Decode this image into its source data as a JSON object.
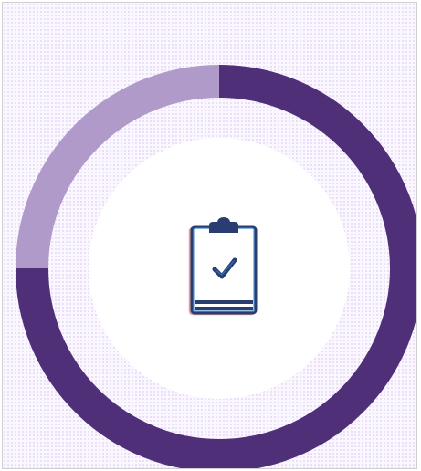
{
  "progress_ring": {
    "completed_fraction": 0.75,
    "colors": {
      "completed": "#4e2f78",
      "remaining": "#b09ac9",
      "inner": "#ffffff",
      "background": "#fbf7ff",
      "icon_outline": "#2a3d70",
      "icon_accent": "#2f86d6",
      "icon_shadow": "#c7523f"
    }
  },
  "center_icon": {
    "name": "clipboard-check-icon"
  }
}
